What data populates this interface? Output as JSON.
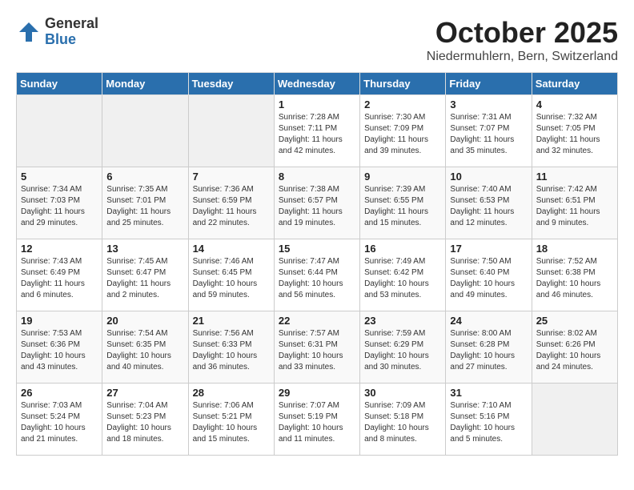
{
  "logo": {
    "general": "General",
    "blue": "Blue"
  },
  "title": "October 2025",
  "subtitle": "Niedermuhlern, Bern, Switzerland",
  "days_of_week": [
    "Sunday",
    "Monday",
    "Tuesday",
    "Wednesday",
    "Thursday",
    "Friday",
    "Saturday"
  ],
  "weeks": [
    [
      {
        "day": "",
        "info": ""
      },
      {
        "day": "",
        "info": ""
      },
      {
        "day": "",
        "info": ""
      },
      {
        "day": "1",
        "info": "Sunrise: 7:28 AM\nSunset: 7:11 PM\nDaylight: 11 hours and 42 minutes."
      },
      {
        "day": "2",
        "info": "Sunrise: 7:30 AM\nSunset: 7:09 PM\nDaylight: 11 hours and 39 minutes."
      },
      {
        "day": "3",
        "info": "Sunrise: 7:31 AM\nSunset: 7:07 PM\nDaylight: 11 hours and 35 minutes."
      },
      {
        "day": "4",
        "info": "Sunrise: 7:32 AM\nSunset: 7:05 PM\nDaylight: 11 hours and 32 minutes."
      }
    ],
    [
      {
        "day": "5",
        "info": "Sunrise: 7:34 AM\nSunset: 7:03 PM\nDaylight: 11 hours and 29 minutes."
      },
      {
        "day": "6",
        "info": "Sunrise: 7:35 AM\nSunset: 7:01 PM\nDaylight: 11 hours and 25 minutes."
      },
      {
        "day": "7",
        "info": "Sunrise: 7:36 AM\nSunset: 6:59 PM\nDaylight: 11 hours and 22 minutes."
      },
      {
        "day": "8",
        "info": "Sunrise: 7:38 AM\nSunset: 6:57 PM\nDaylight: 11 hours and 19 minutes."
      },
      {
        "day": "9",
        "info": "Sunrise: 7:39 AM\nSunset: 6:55 PM\nDaylight: 11 hours and 15 minutes."
      },
      {
        "day": "10",
        "info": "Sunrise: 7:40 AM\nSunset: 6:53 PM\nDaylight: 11 hours and 12 minutes."
      },
      {
        "day": "11",
        "info": "Sunrise: 7:42 AM\nSunset: 6:51 PM\nDaylight: 11 hours and 9 minutes."
      }
    ],
    [
      {
        "day": "12",
        "info": "Sunrise: 7:43 AM\nSunset: 6:49 PM\nDaylight: 11 hours and 6 minutes."
      },
      {
        "day": "13",
        "info": "Sunrise: 7:45 AM\nSunset: 6:47 PM\nDaylight: 11 hours and 2 minutes."
      },
      {
        "day": "14",
        "info": "Sunrise: 7:46 AM\nSunset: 6:45 PM\nDaylight: 10 hours and 59 minutes."
      },
      {
        "day": "15",
        "info": "Sunrise: 7:47 AM\nSunset: 6:44 PM\nDaylight: 10 hours and 56 minutes."
      },
      {
        "day": "16",
        "info": "Sunrise: 7:49 AM\nSunset: 6:42 PM\nDaylight: 10 hours and 53 minutes."
      },
      {
        "day": "17",
        "info": "Sunrise: 7:50 AM\nSunset: 6:40 PM\nDaylight: 10 hours and 49 minutes."
      },
      {
        "day": "18",
        "info": "Sunrise: 7:52 AM\nSunset: 6:38 PM\nDaylight: 10 hours and 46 minutes."
      }
    ],
    [
      {
        "day": "19",
        "info": "Sunrise: 7:53 AM\nSunset: 6:36 PM\nDaylight: 10 hours and 43 minutes."
      },
      {
        "day": "20",
        "info": "Sunrise: 7:54 AM\nSunset: 6:35 PM\nDaylight: 10 hours and 40 minutes."
      },
      {
        "day": "21",
        "info": "Sunrise: 7:56 AM\nSunset: 6:33 PM\nDaylight: 10 hours and 36 minutes."
      },
      {
        "day": "22",
        "info": "Sunrise: 7:57 AM\nSunset: 6:31 PM\nDaylight: 10 hours and 33 minutes."
      },
      {
        "day": "23",
        "info": "Sunrise: 7:59 AM\nSunset: 6:29 PM\nDaylight: 10 hours and 30 minutes."
      },
      {
        "day": "24",
        "info": "Sunrise: 8:00 AM\nSunset: 6:28 PM\nDaylight: 10 hours and 27 minutes."
      },
      {
        "day": "25",
        "info": "Sunrise: 8:02 AM\nSunset: 6:26 PM\nDaylight: 10 hours and 24 minutes."
      }
    ],
    [
      {
        "day": "26",
        "info": "Sunrise: 7:03 AM\nSunset: 5:24 PM\nDaylight: 10 hours and 21 minutes."
      },
      {
        "day": "27",
        "info": "Sunrise: 7:04 AM\nSunset: 5:23 PM\nDaylight: 10 hours and 18 minutes."
      },
      {
        "day": "28",
        "info": "Sunrise: 7:06 AM\nSunset: 5:21 PM\nDaylight: 10 hours and 15 minutes."
      },
      {
        "day": "29",
        "info": "Sunrise: 7:07 AM\nSunset: 5:19 PM\nDaylight: 10 hours and 11 minutes."
      },
      {
        "day": "30",
        "info": "Sunrise: 7:09 AM\nSunset: 5:18 PM\nDaylight: 10 hours and 8 minutes."
      },
      {
        "day": "31",
        "info": "Sunrise: 7:10 AM\nSunset: 5:16 PM\nDaylight: 10 hours and 5 minutes."
      },
      {
        "day": "",
        "info": ""
      }
    ]
  ]
}
